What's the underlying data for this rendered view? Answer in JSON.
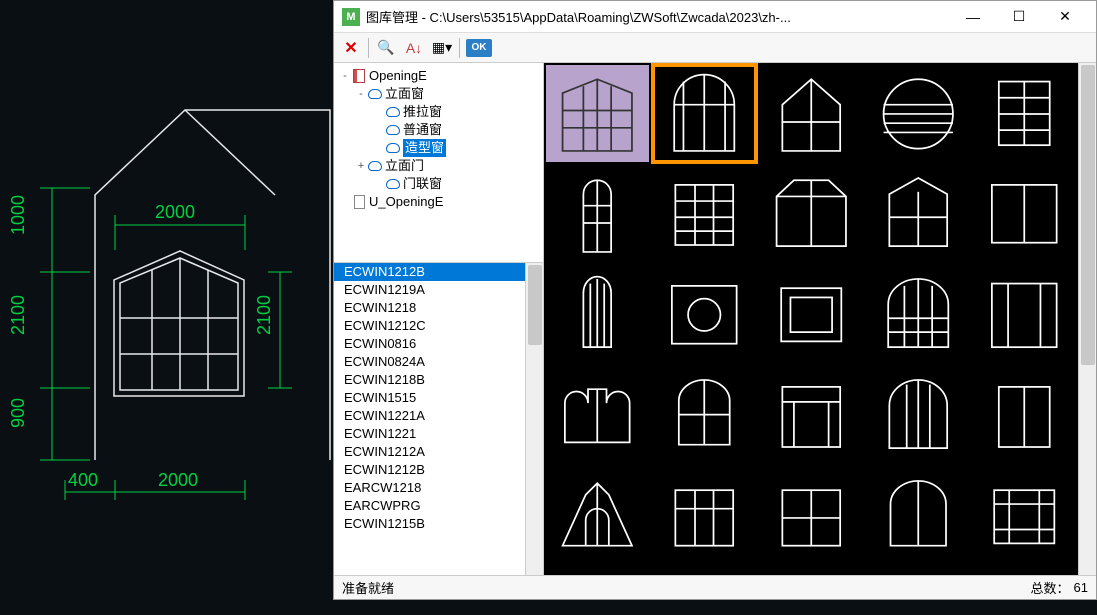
{
  "cad": {
    "dim_2000_top": "2000",
    "dim_1000": "1000",
    "dim_2100_left": "2100",
    "dim_2100_right": "2100",
    "dim_900": "900",
    "dim_400": "400",
    "dim_2000_bottom": "2000"
  },
  "dialog": {
    "title": "图库管理 - C:\\Users\\53515\\AppData\\Roaming\\ZWSoft\\Zwcada\\2023\\zh-...",
    "toolbar": {
      "ok_label": "OK"
    },
    "tree": [
      {
        "depth": 0,
        "icon": "book",
        "exp": "-",
        "label": "OpeningE"
      },
      {
        "depth": 1,
        "icon": "cloud",
        "exp": "-",
        "label": "立面窗"
      },
      {
        "depth": 2,
        "icon": "cloud",
        "exp": "",
        "label": "推拉窗"
      },
      {
        "depth": 2,
        "icon": "cloud",
        "exp": "",
        "label": "普通窗"
      },
      {
        "depth": 2,
        "icon": "cloud",
        "exp": "",
        "label": "造型窗",
        "selected": true
      },
      {
        "depth": 1,
        "icon": "cloud",
        "exp": "+",
        "label": "立面门"
      },
      {
        "depth": 2,
        "icon": "cloud",
        "exp": "",
        "label": "门联窗"
      },
      {
        "depth": 0,
        "icon": "page",
        "exp": "",
        "label": "U_OpeningE"
      }
    ],
    "list": [
      {
        "name": "ECWIN1212B",
        "selected": true
      },
      {
        "name": "ECWIN1219A"
      },
      {
        "name": "ECWIN1218"
      },
      {
        "name": "ECWIN1212C"
      },
      {
        "name": "ECWIN0816"
      },
      {
        "name": "ECWIN0824A"
      },
      {
        "name": "ECWIN1218B"
      },
      {
        "name": "ECWIN1515"
      },
      {
        "name": "ECWIN1221A"
      },
      {
        "name": "ECWIN1221"
      },
      {
        "name": "ECWIN1212A"
      },
      {
        "name": "ECWIN1212B"
      },
      {
        "name": "EARCW1218"
      },
      {
        "name": "EARCWPRG"
      },
      {
        "name": "ECWIN1215B"
      }
    ],
    "status": {
      "left": "准备就绪",
      "right_label": "总数：",
      "right_value": "61"
    },
    "thumb_count": 25,
    "selected_index": 0,
    "highlighted_index": 1
  }
}
